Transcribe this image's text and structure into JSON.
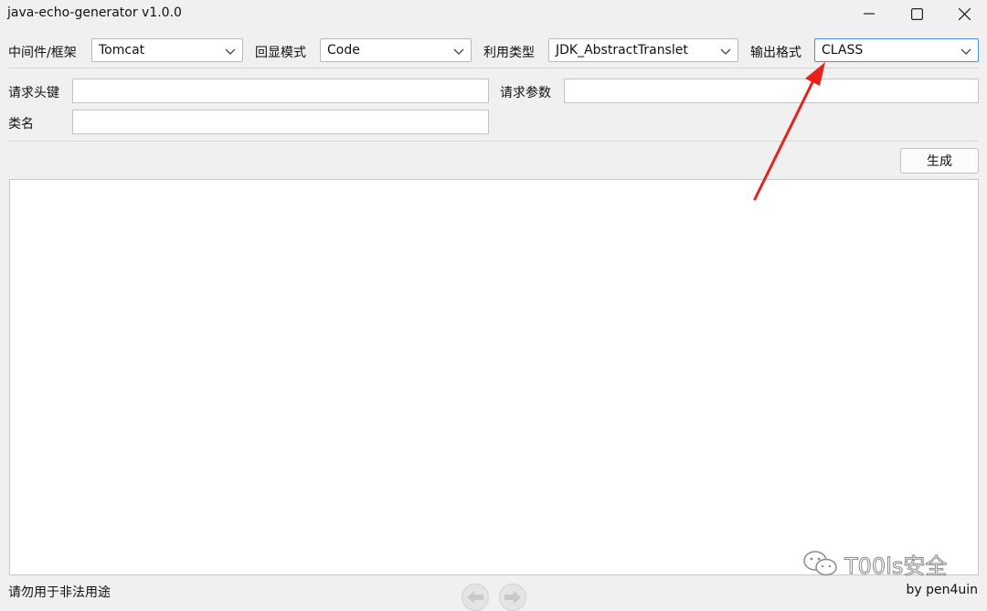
{
  "window": {
    "title": "java-echo-generator v1.0.0"
  },
  "options": {
    "middleware": {
      "label": "中间件/框架",
      "value": "Tomcat"
    },
    "echo_mode": {
      "label": "回显模式",
      "value": "Code"
    },
    "exploit_type": {
      "label": "利用类型",
      "value": "JDK_AbstractTranslet"
    },
    "output_format": {
      "label": "输出格式",
      "value": "CLASS"
    }
  },
  "fields": {
    "header_key": {
      "label": "请求头键",
      "value": ""
    },
    "param": {
      "label": "请求参数",
      "value": ""
    },
    "class_name": {
      "label": "类名",
      "value": ""
    }
  },
  "actions": {
    "generate_label": "生成"
  },
  "output": {
    "text": ""
  },
  "status": {
    "warning": "请勿用于非法用途",
    "author": "by pen4uin"
  },
  "watermark": {
    "text": "T00ls安全"
  },
  "colors": {
    "annotation_arrow": "#e8221a",
    "focus_border": "#4a90d9"
  }
}
